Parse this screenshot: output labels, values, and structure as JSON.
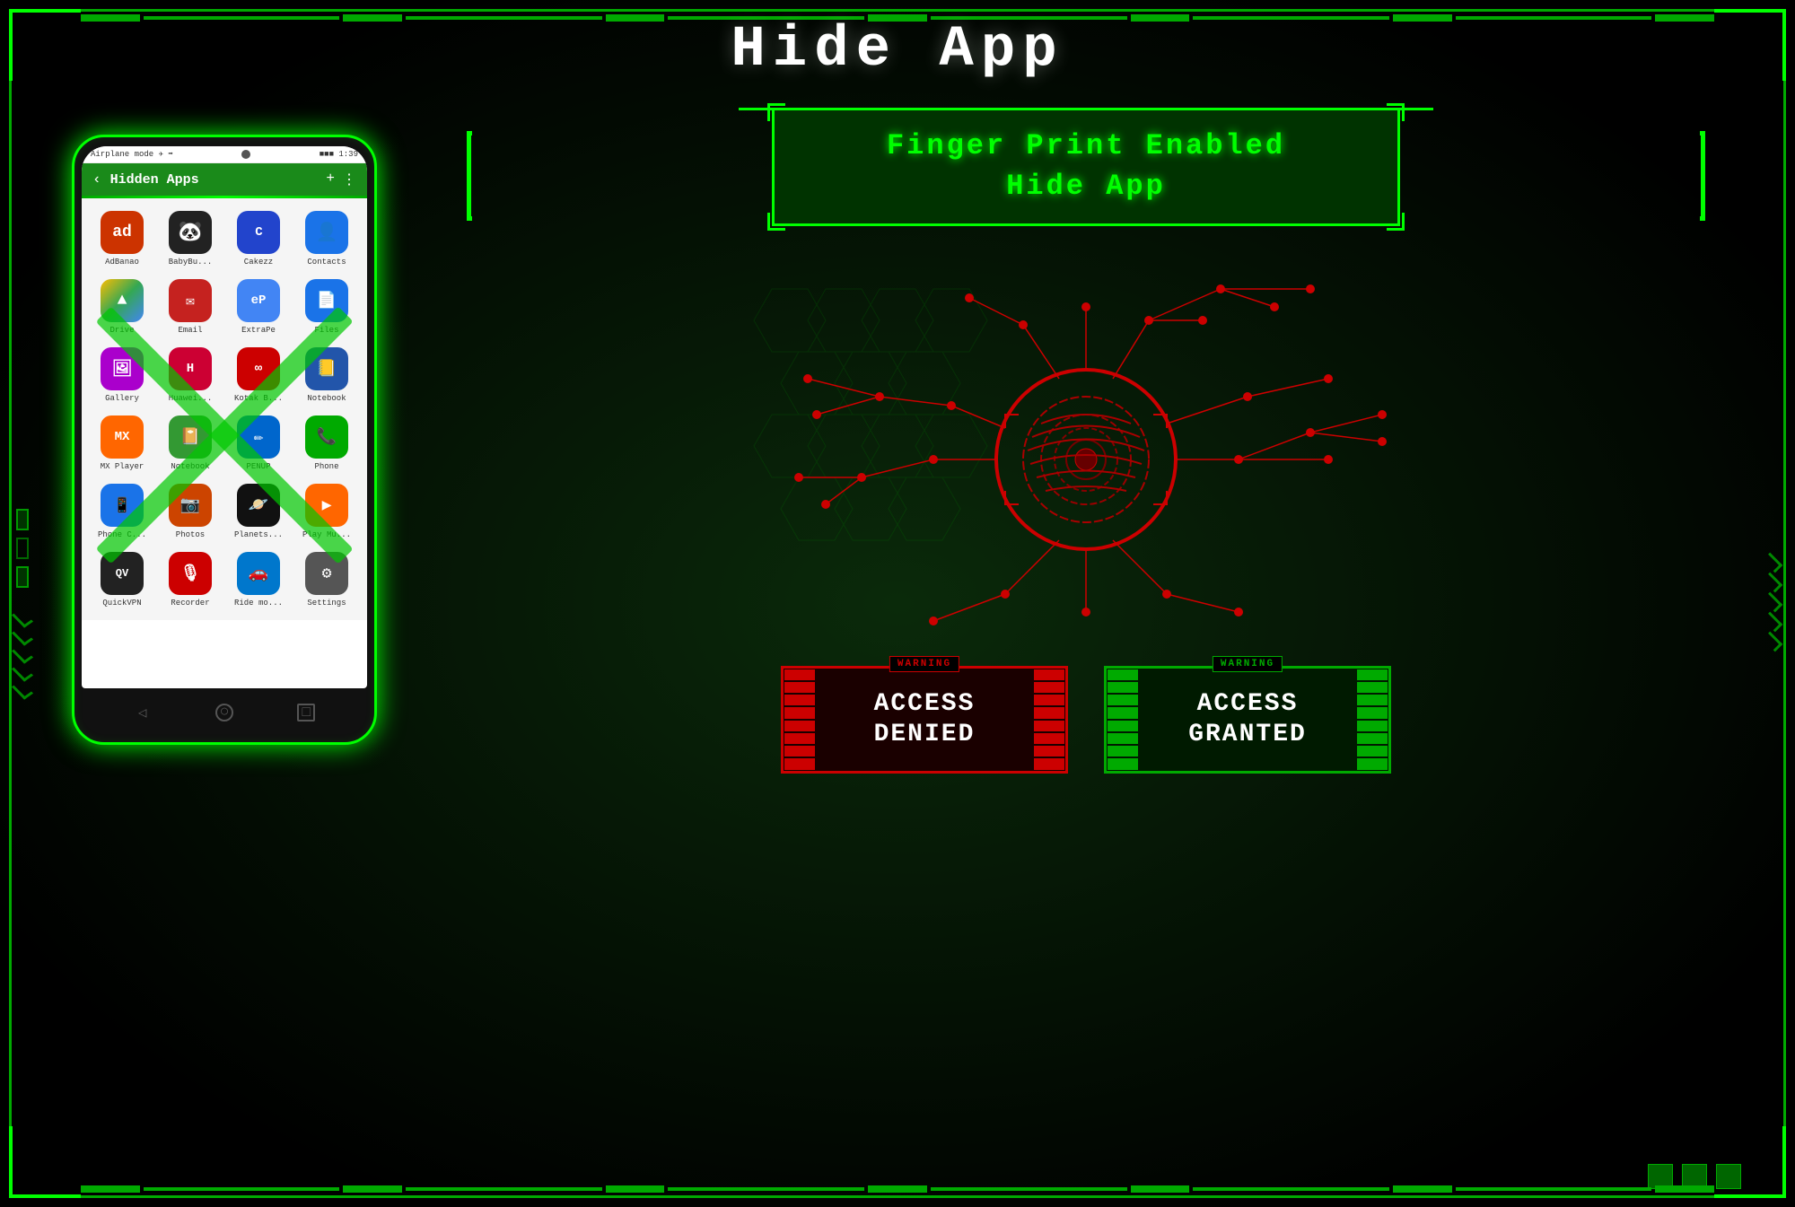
{
  "page": {
    "title": "Hide App",
    "background_color": "#000",
    "accent_color": "#00ff00"
  },
  "header": {
    "title": "Hide App"
  },
  "phone": {
    "status_bar": {
      "left": "Airplane mode",
      "right": "1:39"
    },
    "app_bar": {
      "title": "Hidden Apps"
    },
    "apps": [
      {
        "name": "AdBanao",
        "icon": "ad",
        "label": "AdBanao"
      },
      {
        "name": "BabyBu",
        "icon": "panda",
        "label": "BabyBu..."
      },
      {
        "name": "Cakezz",
        "icon": "cake",
        "label": "Cakezz"
      },
      {
        "name": "Contacts",
        "icon": "contacts",
        "label": "Contacts"
      },
      {
        "name": "Drive",
        "icon": "drive",
        "label": "Drive"
      },
      {
        "name": "Email",
        "icon": "email",
        "label": "Email"
      },
      {
        "name": "ExtraPe",
        "icon": "extra",
        "label": "ExtraPe"
      },
      {
        "name": "Files",
        "icon": "files",
        "label": "Files"
      },
      {
        "name": "Gallery",
        "icon": "gallery",
        "label": "Gallery"
      },
      {
        "name": "Huawei",
        "icon": "huawei",
        "label": "Huawei..."
      },
      {
        "name": "KotakB",
        "icon": "kotak",
        "label": "Kotak B..."
      },
      {
        "name": "Notebook",
        "icon": "notebook",
        "label": "Notebook"
      },
      {
        "name": "MXPlayer",
        "icon": "mxplayer",
        "label": "MX Player"
      },
      {
        "name": "Notebook2",
        "icon": "notebook2",
        "label": "Notebook"
      },
      {
        "name": "PENUP",
        "icon": "penup",
        "label": "PENUP"
      },
      {
        "name": "Phone",
        "icon": "phone",
        "label": "Phone"
      },
      {
        "name": "PhoneC",
        "icon": "phonec",
        "label": "Phone C..."
      },
      {
        "name": "Photos",
        "icon": "photos",
        "label": "Photos"
      },
      {
        "name": "Planets",
        "icon": "planets",
        "label": "Planets..."
      },
      {
        "name": "PlayMu",
        "icon": "playmu",
        "label": "Play Mu..."
      },
      {
        "name": "QuickVPN",
        "icon": "qvpn",
        "label": "QuickVPN"
      },
      {
        "name": "Recorder",
        "icon": "recorder",
        "label": "Recorder"
      },
      {
        "name": "RideMo",
        "icon": "ridem",
        "label": "Ride mo..."
      },
      {
        "name": "Settings",
        "icon": "settings",
        "label": "Settings"
      }
    ]
  },
  "fingerprint_panel": {
    "title_line1": "Finger Print Enabled",
    "title_line2": "Hide App"
  },
  "badges": {
    "denied": {
      "warning": "WARNING",
      "text_line1": "ACCESS",
      "text_line2": "DENIED"
    },
    "granted": {
      "warning": "WARNING",
      "text_line1": "ACCESS",
      "text_line2": "GRANTED"
    }
  },
  "decorations": {
    "dots": [
      "#006600",
      "#006600",
      "#006600"
    ]
  }
}
